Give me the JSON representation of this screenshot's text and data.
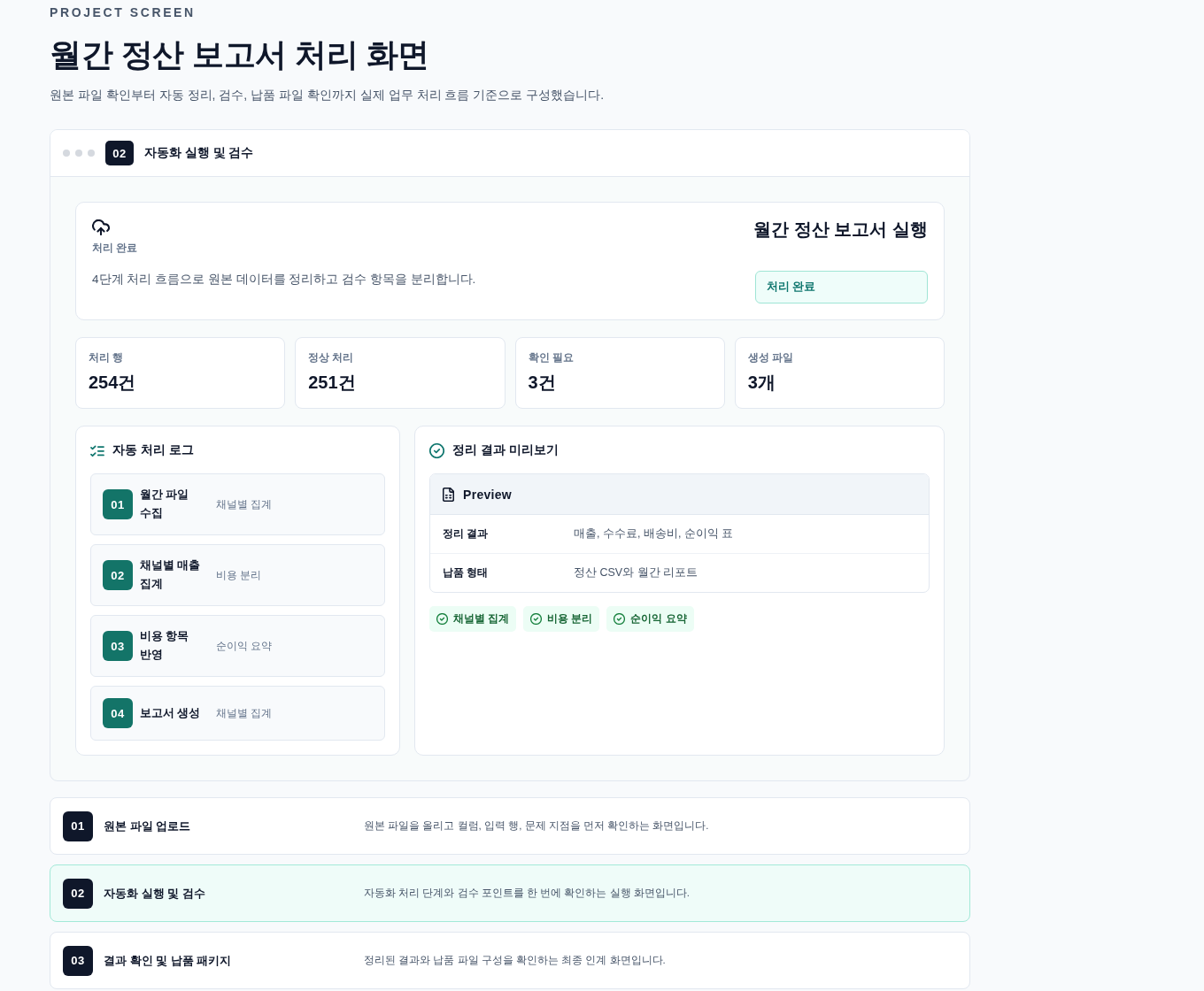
{
  "header": {
    "eyebrow": "PROJECT SCREEN",
    "title": "월간 정산 보고서 처리 화면",
    "subtitle": "원본 파일 확인부터 자동 정리, 검수, 납품 파일 확인까지 실제 업무 처리 흐름 기준으로 구성했습니다."
  },
  "window": {
    "step": "02",
    "title": "자동화 실행 및 검수"
  },
  "summary": {
    "label": "처리 완료",
    "description": "4단계 처리 흐름으로 원본 데이터를 정리하고 검수 항목을 분리합니다.",
    "title": "월간 정산 보고서 실행",
    "status": "처리 완료"
  },
  "stats": [
    {
      "label": "처리 행",
      "value": "254건"
    },
    {
      "label": "정상 처리",
      "value": "251건"
    },
    {
      "label": "확인 필요",
      "value": "3건"
    },
    {
      "label": "생성 파일",
      "value": "3개"
    }
  ],
  "log": {
    "title": "자동 처리 로그",
    "items": [
      {
        "step": "01",
        "title": "월간 파일 수집",
        "detail": "채널별 집계"
      },
      {
        "step": "02",
        "title": "채널별 매출 집계",
        "detail": "비용 분리"
      },
      {
        "step": "03",
        "title": "비용 항목 반영",
        "detail": "순이익 요약"
      },
      {
        "step": "04",
        "title": "보고서 생성",
        "detail": "채널별 집계"
      }
    ]
  },
  "preview": {
    "title": "정리 결과 미리보기",
    "table_title": "Preview",
    "rows": [
      {
        "label": "정리 결과",
        "value": "매출, 수수료, 배송비, 순이익 표"
      },
      {
        "label": "납품 형태",
        "value": "정산 CSV와 월간 리포트"
      }
    ],
    "tags": [
      "채널별 집계",
      "비용 분리",
      "순이익 요약"
    ]
  },
  "screens": [
    {
      "step": "01",
      "title": "원본 파일 업로드",
      "description": "원본 파일을 올리고 컬럼, 입력 행, 문제 지점을 먼저 확인하는 화면입니다.",
      "selected": false
    },
    {
      "step": "02",
      "title": "자동화 실행 및 검수",
      "description": "자동화 처리 단계와 검수 포인트를 한 번에 확인하는 실행 화면입니다.",
      "selected": true
    },
    {
      "step": "03",
      "title": "결과 확인 및 납품 패키지",
      "description": "정리된 결과와 납품 파일 구성을 확인하는 최종 인계 화면입니다.",
      "selected": false
    }
  ]
}
